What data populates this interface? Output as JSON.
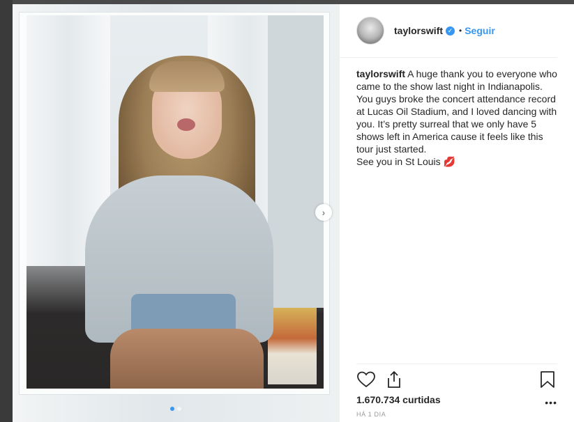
{
  "post": {
    "username": "taylorswift",
    "follow_label": "Seguir",
    "separator": "•",
    "caption_text": " A huge thank you to everyone who came to the show last night in Indianapolis. You guys broke the concert attendance record at Lucas Oil Stadium, and I loved dancing with you. It’s pretty surreal that we only have 5 shows left in America cause it feels like this tour just started.\nSee you in St Louis 💋",
    "likes": "1.670.734 curtidas",
    "more": "•••",
    "time": "HÁ 1 DIA"
  },
  "carousel": {
    "next_glyph": "›",
    "slide_count": 2,
    "active_slide": 1
  },
  "icons": {
    "verified": "verified-badge-icon",
    "like": "heart-icon",
    "share": "share-icon",
    "save": "bookmark-icon",
    "next": "chevron-right-icon"
  },
  "colors": {
    "accent": "#3897f0",
    "text": "#262626",
    "muted": "#999999"
  }
}
